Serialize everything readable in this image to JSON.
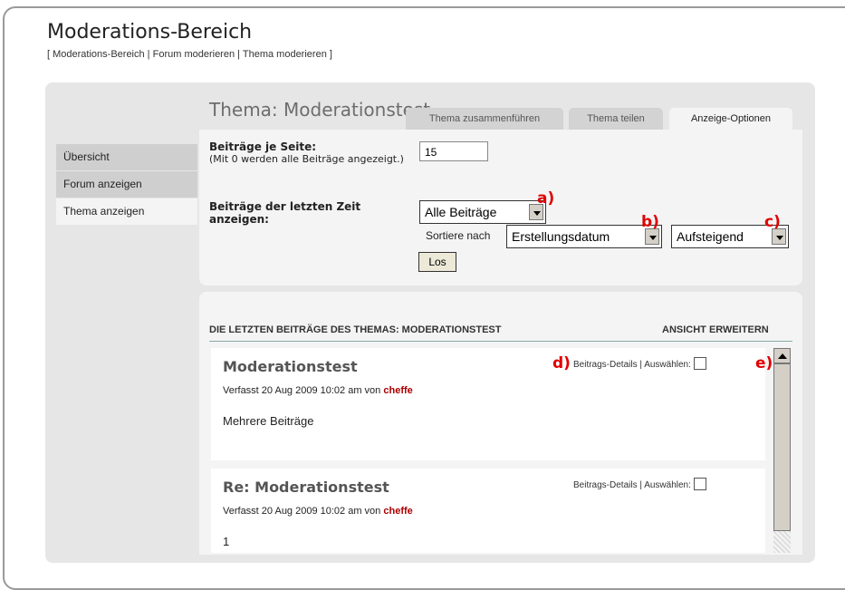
{
  "header": {
    "title": "Moderations-Bereich",
    "breadcrumb_open": "[ ",
    "breadcrumb": [
      "Moderations-Bereich",
      "Forum moderieren",
      "Thema moderieren"
    ],
    "breadcrumb_sep": " | ",
    "breadcrumb_close": " ]"
  },
  "topic": {
    "title": "Thema: Moderationstest"
  },
  "tabs": [
    {
      "label": "Thema zusammenführen"
    },
    {
      "label": "Thema teilen"
    },
    {
      "label": "Anzeige-Optionen",
      "active": true
    }
  ],
  "sidebar": {
    "items": [
      {
        "label": "Übersicht"
      },
      {
        "label": "Forum anzeigen"
      },
      {
        "label": "Thema anzeigen",
        "active": true
      }
    ]
  },
  "options": {
    "per_page_label": "Beiträge je Seite:",
    "per_page_hint": "(Mit 0 werden alle Beiträge angezeigt.)",
    "per_page_value": "15",
    "recent_label": "Beiträge der letzten Zeit anzeigen:",
    "recent_value": "Alle Beiträge",
    "sort_label": "Sortiere nach",
    "sort_value": "Erstellungsdatum",
    "order_value": "Aufsteigend",
    "go_label": "Los"
  },
  "markers": {
    "a": "a)",
    "b": "b)",
    "c": "c)",
    "d": "d)",
    "e": "e)"
  },
  "posts_section": {
    "heading": "DIE LETZTEN BEITRÄGE DES THEMAS: MODERATIONSTEST",
    "expand_label": "ANSICHT ERWEITERN"
  },
  "posts": [
    {
      "title": "Moderationstest",
      "meta_prefix": "Verfasst 20 Aug 2009 10:02 am von ",
      "author": "cheffe",
      "body": "Mehrere Beiträge",
      "details_label": "Beitrags-Details",
      "select_label": " | Auswählen:"
    },
    {
      "title": "Re: Moderationstest",
      "meta_prefix": "Verfasst 20 Aug 2009 10:02 am von ",
      "author": "cheffe",
      "body": "1",
      "details_label": "Beitrags-Details",
      "select_label": " | Auswählen:"
    }
  ],
  "colors": {
    "accent_red": "#e00000",
    "author": "#a00000",
    "panel": "#e6e6e6"
  }
}
